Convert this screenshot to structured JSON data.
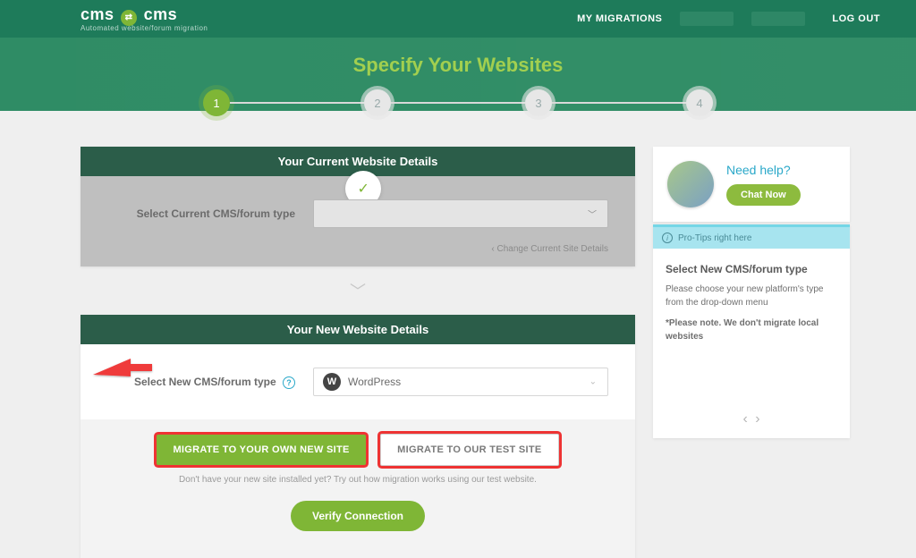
{
  "nav": {
    "brand_a": "cms",
    "brand_b": "cms",
    "tagline": "Automated website/forum migration",
    "my_migrations": "MY MIGRATIONS",
    "logout": "LOG OUT"
  },
  "hero": {
    "title": "Specify Your Websites"
  },
  "steps": [
    "1",
    "2",
    "3",
    "4"
  ],
  "current": {
    "header": "Your Current Website Details",
    "label": "Select Current CMS/forum type",
    "change": "Change Current Site Details"
  },
  "newsite": {
    "header": "Your New Website Details",
    "label": "Select New CMS/forum type",
    "selected": "WordPress"
  },
  "buttons": {
    "own": "MIGRATE TO YOUR OWN NEW SITE",
    "test": "MIGRATE TO OUR TEST SITE",
    "hint": "Don't have your new site installed yet? Try out how migration works using our test website.",
    "verify": "Verify Connection"
  },
  "help": {
    "need": "Need help?",
    "chat": "Chat Now"
  },
  "tips": {
    "header": "Pro-Tips right here",
    "title": "Select New CMS/forum type",
    "p1": "Please choose your new platform's type from the drop-down menu",
    "p2": "*Please note. We don't migrate local websites"
  }
}
